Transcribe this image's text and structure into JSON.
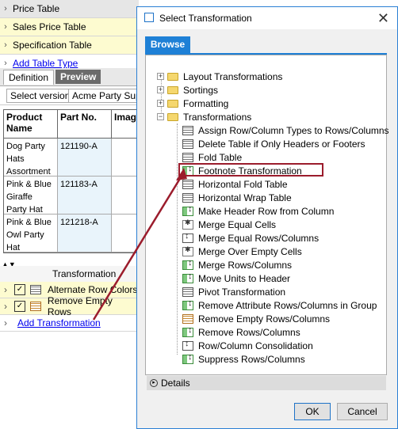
{
  "app": {
    "table_rows": [
      {
        "label": "Price Table"
      },
      {
        "label": "Sales Price Table"
      },
      {
        "label": "Specification Table"
      }
    ],
    "add_table_type": "Add Table Type",
    "tabs": [
      "Definition",
      "Preview"
    ],
    "select_version_label": "Select version",
    "version_value": "Acme Party Supp",
    "grid": {
      "headers": [
        "Product Name",
        "Part No.",
        "Imag"
      ],
      "rows": [
        {
          "name": "Dog Party Hats Assortment",
          "part": "121190-A"
        },
        {
          "name": "Pink & Blue Giraffe Party Hat",
          "part": "121183-A"
        },
        {
          "name": "Pink & Blue Owl Party Hat",
          "part": "121218-A"
        }
      ]
    },
    "transformation_header": "Transformation",
    "transformations": [
      {
        "label": "Alternate Row Colors"
      },
      {
        "label": "Remove Empty Rows"
      }
    ],
    "add_transformation": "Add Transformation"
  },
  "dialog": {
    "title": "Select Transformation",
    "browse_tab": "Browse",
    "folders": [
      {
        "label": "Layout Transformations",
        "expanded": false
      },
      {
        "label": "Sortings",
        "expanded": false
      },
      {
        "label": "Formatting",
        "expanded": false
      },
      {
        "label": "Transformations",
        "expanded": true
      }
    ],
    "items": [
      {
        "label": "Assign Row/Column Types to Rows/Columns",
        "icon": "table"
      },
      {
        "label": "Delete Table if Only Headers or Footers",
        "icon": "table"
      },
      {
        "label": "Fold Table",
        "icon": "table"
      },
      {
        "label": "Footnote Transformation",
        "icon": "green"
      },
      {
        "label": "Horizontal Fold Table",
        "icon": "table"
      },
      {
        "label": "Horizontal Wrap Table",
        "icon": "table"
      },
      {
        "label": "Make Header Row from Column",
        "icon": "green"
      },
      {
        "label": "Merge Equal Cells",
        "icon": "doc"
      },
      {
        "label": "Merge Equal Rows/Columns",
        "icon": "arrow"
      },
      {
        "label": "Merge Over Empty Cells",
        "icon": "doc"
      },
      {
        "label": "Merge Rows/Columns",
        "icon": "green"
      },
      {
        "label": "Move Units to Header",
        "icon": "green"
      },
      {
        "label": "Pivot Transformation",
        "icon": "table"
      },
      {
        "label": "Remove Attribute Rows/Columns in Group",
        "icon": "green"
      },
      {
        "label": "Remove Empty Rows/Columns",
        "icon": "orange"
      },
      {
        "label": "Remove Rows/Columns",
        "icon": "green"
      },
      {
        "label": "Row/Column Consolidation",
        "icon": "arrow"
      },
      {
        "label": "Suppress Rows/Columns",
        "icon": "green"
      }
    ],
    "details_label": "Details",
    "ok_label": "OK",
    "cancel_label": "Cancel"
  },
  "colors": {
    "accent": "#1e80d6",
    "highlight": "#9b1c2c",
    "row_yellow": "#fdfbd0"
  }
}
